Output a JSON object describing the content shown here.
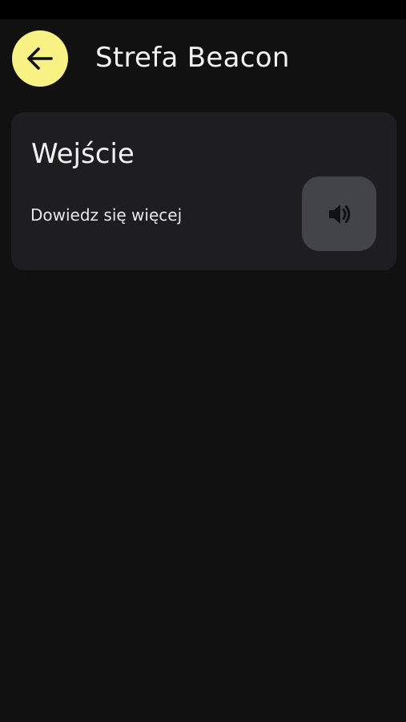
{
  "header": {
    "title": "Strefa Beacon",
    "back_icon": "arrow-left-icon",
    "back_button_color": "#f7f283"
  },
  "card": {
    "title": "Wejście",
    "link_text": "Dowiedz się więcej",
    "audio_icon": "speaker-icon"
  },
  "colors": {
    "background": "#111111",
    "card_background": "#1e1e20",
    "audio_button_background": "#42444a",
    "accent": "#f7f283"
  }
}
